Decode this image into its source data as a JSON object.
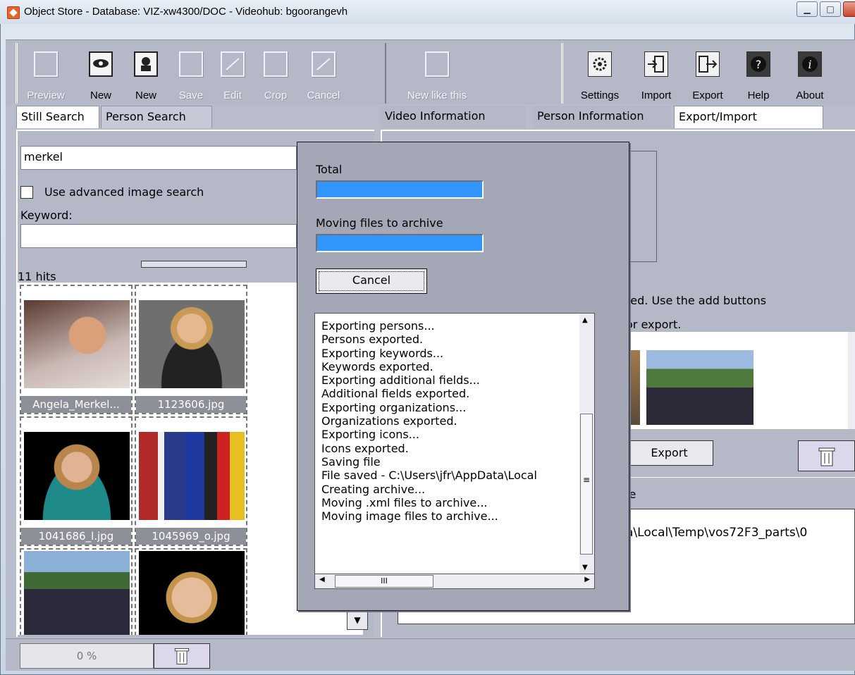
{
  "window": {
    "title": "Object Store  -  Database: VIZ-xw4300/DOC  -  Videohub: bgoorangevh"
  },
  "toolbar": {
    "left_buttons": [
      {
        "label": "Preview",
        "icon": "blank-frame-icon",
        "enabled": false
      },
      {
        "label": "New",
        "icon": "eye-icon",
        "enabled": true
      },
      {
        "label": "New",
        "icon": "person-icon",
        "enabled": true
      },
      {
        "label": "Save",
        "icon": "save-frame-icon",
        "enabled": false
      },
      {
        "label": "Edit",
        "icon": "edit-frame-icon",
        "enabled": false
      },
      {
        "label": "Crop",
        "icon": "crop-frame-icon",
        "enabled": false
      },
      {
        "label": "Cancel",
        "icon": "cancel-frame-icon",
        "enabled": false
      },
      {
        "label": "New like this",
        "icon": "blank-frame-icon",
        "enabled": false
      }
    ],
    "right_buttons": [
      {
        "label": "Settings",
        "icon": "gear-icon"
      },
      {
        "label": "Import",
        "icon": "import-icon"
      },
      {
        "label": "Export",
        "icon": "export-icon"
      },
      {
        "label": "Help",
        "icon": "help-icon"
      },
      {
        "label": "About",
        "icon": "about-icon"
      }
    ]
  },
  "left_tabs": [
    "Still Search",
    "Person Search"
  ],
  "right_tabs": [
    "Video Information",
    "Person Information",
    "Export/Import"
  ],
  "search": {
    "query": "merkel",
    "advanced_label": "Use advanced image search",
    "keyword_label": "Keyword:",
    "keyword_value": "",
    "hits_label": "11 hits"
  },
  "thumbnails": [
    {
      "caption": "Angela_Merkel..."
    },
    {
      "caption": "1123606.jpg"
    },
    {
      "caption": "1041686_l.jpg"
    },
    {
      "caption": "1045969_o.jpg"
    },
    {
      "caption": ""
    },
    {
      "caption": ""
    }
  ],
  "right_panel": {
    "info_line1": "ted. Use the add buttons",
    "info_line2": "or export.",
    "export_button": "Export",
    "file_label": "le",
    "path_text": "a\\Local\\Temp\\vos72F3_parts\\0"
  },
  "status": {
    "progress_text": "0 %"
  },
  "dialog": {
    "total_label": "Total",
    "total_progress": 1.0,
    "moving_label": "Moving files to archive",
    "moving_progress": 1.0,
    "cancel_label": "Cancel",
    "log_lines": [
      "Exporting persons...",
      "Persons exported.",
      "Exporting keywords...",
      "Keywords exported.",
      "Exporting additional fields...",
      "Additional fields exported.",
      "Exporting organizations...",
      "Organizations exported.",
      "Exporting icons...",
      "Icons exported.",
      "Saving file",
      "File saved - C:\\Users\\jfr\\AppData\\Local",
      "Creating archive...",
      "Moving .xml files to archive...",
      "Moving image files to archive..."
    ],
    "hscroll_thumb_glyph": "III",
    "vscroll_thumb_glyph": "≡"
  },
  "colors": {
    "progress_fill": "#3296ff",
    "panel_bg": "#b4b8c7",
    "dialog_bg": "#a4a7b6"
  }
}
